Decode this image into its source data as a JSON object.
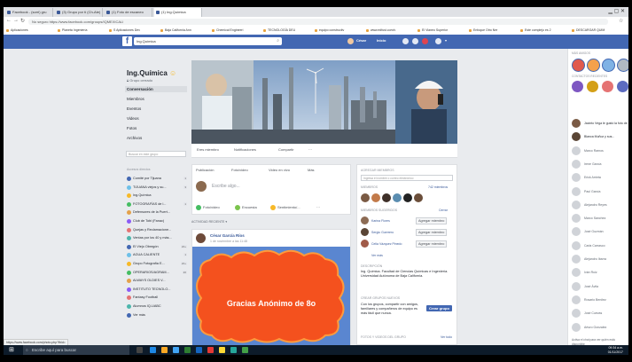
{
  "browser": {
    "tabs": [
      {
        "label": "Facebook - (sorri) gru"
      },
      {
        "label": "(3) Grupo por ti (Ch-Ate)"
      },
      {
        "label": "(1) Foto de escaneo"
      },
      {
        "label": "(1) Ing.Química"
      }
    ],
    "back_icon": "back-arrow-icon",
    "url": "No seguro   https://www.facebook.com/groups/IQMEXICALI",
    "bookmarks": [
      "Aplicaciones",
      "Planeta Ingeniería",
      "S Aplicaciones Dev",
      "Baja California Ann",
      "Chemical Engineeri",
      "TECNOLOGÍA DEU",
      "equipo constructiv",
      "www.edfust.com/v",
      "El Vianeo Superior",
      "Enfoque Otro Ner",
      "Este complejo es 2",
      "DESCARGAR QUIM"
    ]
  },
  "fb_header": {
    "logo": "f",
    "search_value": "Ing.Química",
    "nav": [
      "César",
      "Inicio"
    ],
    "nav_icons": [
      "friends-icon",
      "messages-icon",
      "notifications-icon",
      "help-icon"
    ]
  },
  "group": {
    "name": "Ing.Química",
    "type": "Grupo cerrado",
    "nav": [
      "Conversación",
      "Miembros",
      "Eventos",
      "Videos",
      "Fotos",
      "Archivos"
    ],
    "search_placeholder": "Buscar en este grupo",
    "shortcuts_header": "Accesos directos",
    "shortcuts": [
      {
        "label": "Comité por Tijuana",
        "count": "1"
      },
      {
        "label": "TIJUANA viejos y su...",
        "count": "3"
      },
      {
        "label": "Ing.Química",
        "count": ""
      },
      {
        "label": "FOTOGRAFÍAS de l...",
        "count": "1"
      },
      {
        "label": "Defensores de la Puert...",
        "count": ""
      },
      {
        "label": "Club de Tobi (Fanac)",
        "count": ""
      },
      {
        "label": "Quejas y Reclamacione...",
        "count": ""
      },
      {
        "label": "Ventas por los 40 y más...",
        "count": ""
      },
      {
        "label": "El Viejo Obregón",
        "count": "20+"
      },
      {
        "label": "AGUA CALIENTE",
        "count": "1"
      },
      {
        "label": "Grupo Fotografía E...",
        "count": "20+"
      },
      {
        "label": "OPERARIOS/AGRAM...",
        "count": "20"
      },
      {
        "label": "ALWAYS OLDIES V...",
        "count": ""
      },
      {
        "label": "INSTITUTO TECNOLO...",
        "count": ""
      },
      {
        "label": "Fantasy Football",
        "count": ""
      },
      {
        "label": "Alumnos IQ-UABC",
        "count": ""
      },
      {
        "label": "Ver más",
        "count": ""
      }
    ],
    "cover_actions": [
      "Eres miembro",
      "Notificaciones",
      "Compartir",
      "···"
    ]
  },
  "composer": {
    "tabs": [
      "Publicación",
      "Foto/video",
      "Video en vivo",
      "Más"
    ],
    "placeholder": "Escribe algo...",
    "options": [
      "Foto/video",
      "Encuesta",
      "Sentimiento/...",
      "···"
    ]
  },
  "feed": {
    "recent_label": "ACTIVIDAD RECIENTE",
    "post": {
      "author": "César García Ríos",
      "time": "1 de noviembre a las 11:48",
      "image_text": "Gracias Anónimo de 8o"
    }
  },
  "right": {
    "add_members": {
      "title": "AGREGAR MIEMBROS",
      "placeholder": "Ingresa el nombre o correo electrónico"
    },
    "members": {
      "title": "MIEMBROS",
      "count": "742 miembros"
    },
    "suggested": {
      "title": "MIEMBROS SUGERIDOS",
      "link": "Cerrar",
      "items": [
        {
          "name": "Karina Flores",
          "action": "Agregar miembro"
        },
        {
          "name": "Sergio Guerrero",
          "action": "Agregar miembro"
        },
        {
          "name": "Celia Vázquez Pinedo",
          "action": "Agregar miembro"
        }
      ],
      "more": "Ver más"
    },
    "description": {
      "title": "DESCRIPCIÓN",
      "text": "Ing. Química. Facultad de Ciencias Químicas e Ingeniería. Universidad Autónoma de Baja California."
    },
    "create_group": {
      "title": "CREAR GRUPOS NUEVOS",
      "text": "Con los grupos, compartir con amigos, familiares y compañeros de equipo es más fácil que nunca.",
      "button": "Crear grupo"
    },
    "recent_photos": {
      "title": "FOTOS Y VIDEOS DEL GRUPO",
      "link": "Ver todo"
    }
  },
  "chat": {
    "header": "MÁS AMIGOS",
    "contacts_header": "CONTACTOS RECIENTES",
    "items": [
      "Jacinto Vega le gustó la foto de Sergio Gaston Ureña",
      "Blanca Muñoz y sus...",
      "Marco Ramos",
      "Irene García",
      "Erick Arrieta",
      "Paul García",
      "Alejandro Reyes",
      "Marco Sánchez",
      "José Guzmán",
      "Carla Carrasco",
      "Alejandro Ibarra",
      "Iván Ruiz",
      "José Ávila",
      "Rosario Benítez",
      "José Cuevas",
      "Arturo Gonzalez"
    ],
    "footer": "Activa el chat para ver quién está disponible"
  },
  "statusbar": "https://www.facebook.com/photo.php?fbid=",
  "taskbar": {
    "search": "Escribe aquí para buscar",
    "time": "09:34 a.m.",
    "date": "01/11/2017"
  }
}
